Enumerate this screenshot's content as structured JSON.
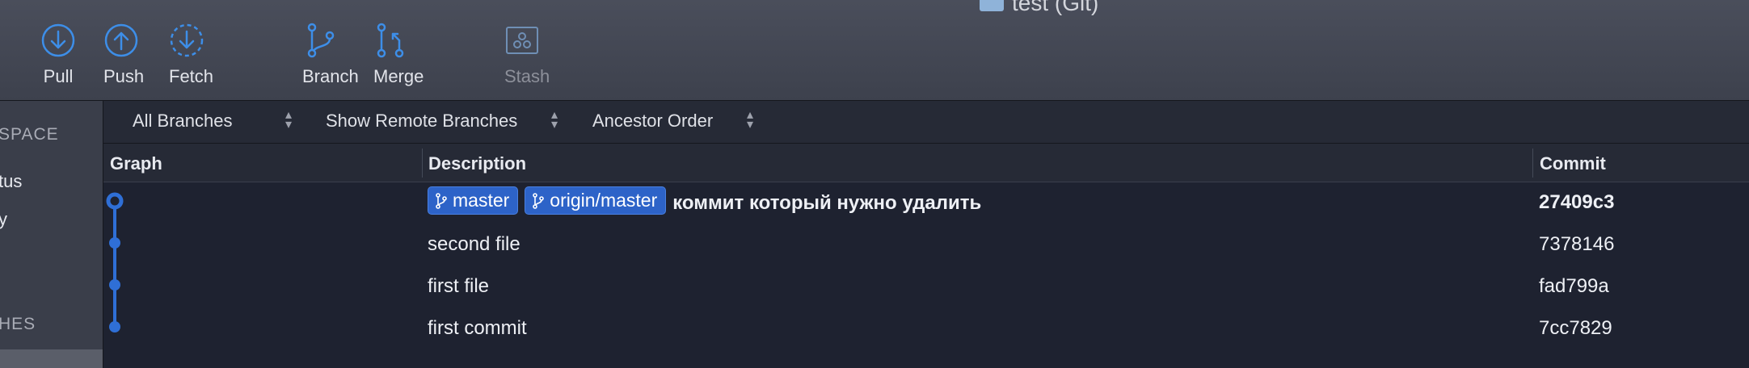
{
  "window": {
    "title": "test (Git)"
  },
  "toolbar": {
    "buttons": [
      {
        "id": "pull",
        "label": "Pull",
        "icon": "pull-icon",
        "enabled": true
      },
      {
        "id": "push",
        "label": "Push",
        "icon": "push-icon",
        "enabled": true
      },
      {
        "id": "fetch",
        "label": "Fetch",
        "icon": "fetch-icon",
        "enabled": true
      },
      {
        "id": "branch",
        "label": "Branch",
        "icon": "branch-icon",
        "enabled": true
      },
      {
        "id": "merge",
        "label": "Merge",
        "icon": "merge-icon",
        "enabled": true
      },
      {
        "id": "stash",
        "label": "Stash",
        "icon": "stash-icon",
        "enabled": false
      }
    ]
  },
  "sidebar": {
    "workspace_header": "SPACE",
    "item_status": "tus",
    "item_history": "y",
    "branches_header": "HES"
  },
  "filters": {
    "branches": "All Branches",
    "remote": "Show Remote Branches",
    "order": "Ancestor Order"
  },
  "columns": {
    "graph": "Graph",
    "description": "Description",
    "commit": "Commit"
  },
  "commits": [
    {
      "refs": [
        "master",
        "origin/master"
      ],
      "message": "коммит который нужно удалить",
      "hash": "27409c3",
      "is_head": true
    },
    {
      "refs": [],
      "message": "second file",
      "hash": "7378146",
      "is_head": false
    },
    {
      "refs": [],
      "message": "first file",
      "hash": "fad799a",
      "is_head": false
    },
    {
      "refs": [],
      "message": "first commit",
      "hash": "7cc7829",
      "is_head": false
    }
  ],
  "colors": {
    "accent": "#3d8ee8",
    "graph_line": "#2f6fd6",
    "badge": "#2d63c8",
    "toolbar": "#454955",
    "background": "#1e2230"
  }
}
